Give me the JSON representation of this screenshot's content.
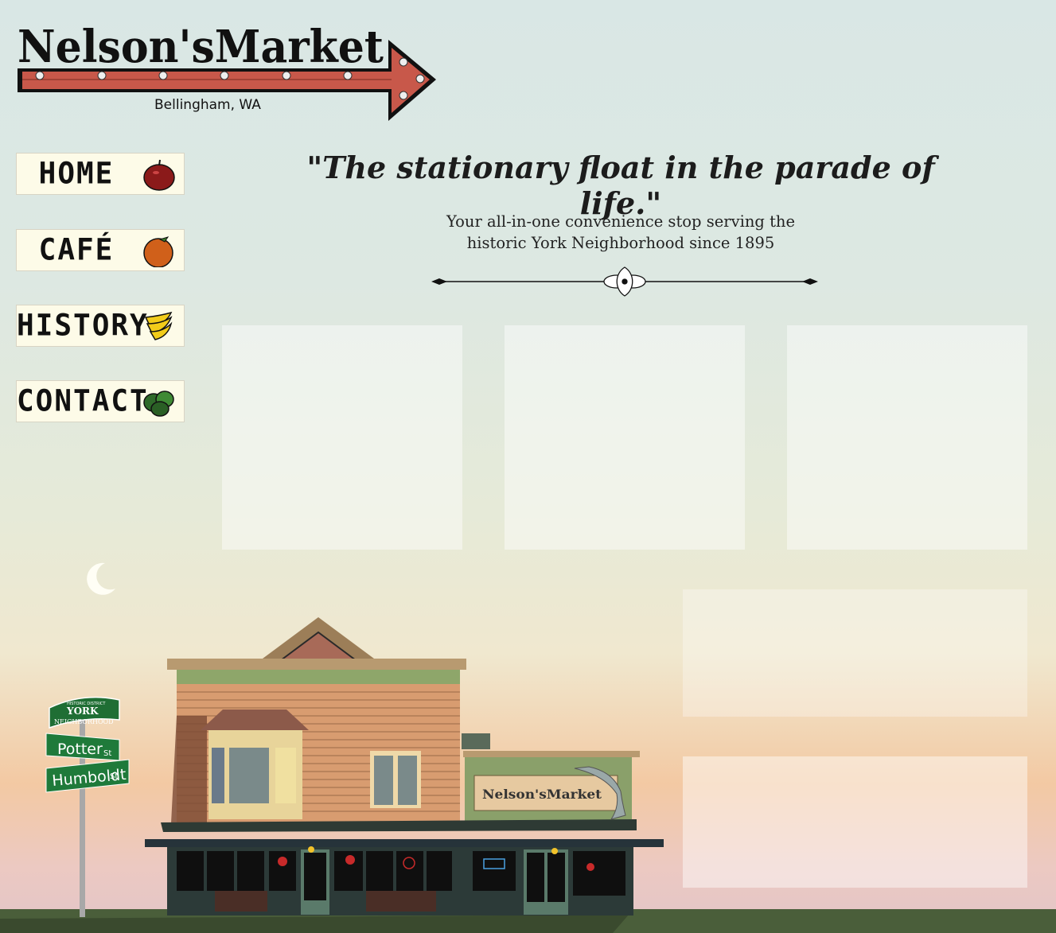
{
  "brand": {
    "name": "Nelson'sMarket",
    "location": "Bellingham, WA"
  },
  "nav": [
    {
      "label": "HOME",
      "icon": "apple-icon"
    },
    {
      "label": "CAFÉ",
      "icon": "orange-icon"
    },
    {
      "label": "HISTORY",
      "icon": "banana-icon"
    },
    {
      "label": "CONTACT",
      "icon": "limes-icon"
    }
  ],
  "hero": {
    "tagline": "\"The stationary float in the parade of life.\"",
    "subtitle_line1": "Your all-in-one convenience stop serving the",
    "subtitle_line2": "historic York Neighborhood since 1895"
  },
  "street_sign": {
    "district": "HISTORIC DISTRICT",
    "neighborhood_top": "YORK",
    "neighborhood_bottom": "NEIGHBORHOOD",
    "street1": "Potter",
    "street1_suffix": "St",
    "street2": "Humboldt",
    "street2_suffix": "St"
  },
  "colors": {
    "sign_red": "#c8584a",
    "sign_green": "#1f7a3a",
    "nav_bg": "#fdfbe8"
  }
}
